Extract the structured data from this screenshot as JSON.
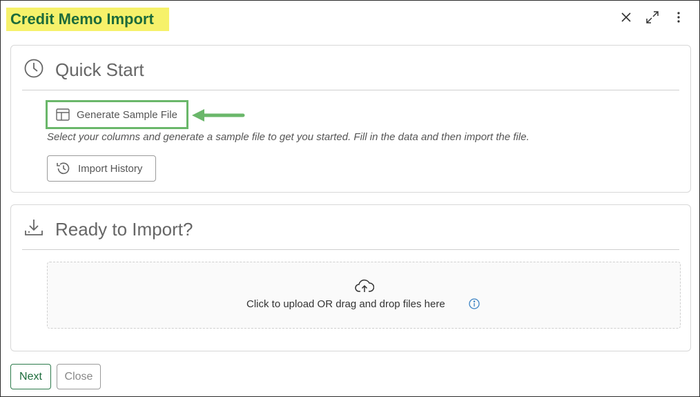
{
  "window": {
    "title": "Credit Memo Import"
  },
  "header_icons": {
    "close": "close-icon",
    "expand": "expand-icon",
    "more": "more-vertical-icon"
  },
  "quick_start": {
    "title": "Quick Start",
    "icon": "clock-icon",
    "generate_label": "Generate Sample File",
    "generate_icon": "table-layout-icon",
    "help_text": "Select your columns and generate a sample file to get you started. Fill in the data and then import the file.",
    "history_label": "Import History",
    "history_icon": "history-icon"
  },
  "ready": {
    "title": "Ready to Import?",
    "icon": "download-tray-icon",
    "dropzone_text": "Click to upload OR drag and drop files here",
    "upload_icon": "cloud-upload-icon",
    "info_icon": "info-icon"
  },
  "footer": {
    "next_label": "Next",
    "close_label": "Close"
  },
  "colors": {
    "title_bg": "#f6f16a",
    "title_text": "#1c6b3b",
    "highlight": "#6ab76a",
    "info": "#3b82c4"
  }
}
